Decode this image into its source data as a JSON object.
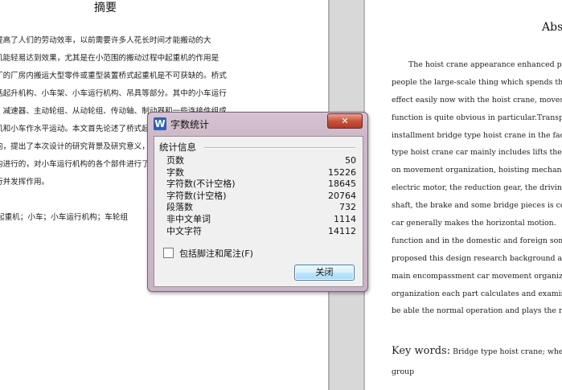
{
  "left_page": {
    "title": "摘要",
    "lines": [
      "提高了人们的劳动效率，以前需要许多人花长时间才能搬动的大",
      "机能轻易达到效果，尤其是在小范围的搬动过程中起重机的作用是",
      "厂的厂房内搬运大型零件或重型装置桥式起重机是不可获缺的。桥式",
      "括起升机构、小车架、小车运行机构、吊具等部分。其中的小车运行",
      "、减速器、主动轮组、从动轮组、传动轴、制动器和一些连接件组成",
      "机和小车作水平运动。本文首先论述了桥式起重机的发展前景与国内",
      "向，提出了本次设计的研究背景及研究意义，接下来介绍了小车运行",
      "构进行的，对小车运行机构的各个部件进行了计算和校核，以保证机",
      "行并发挥作用。"
    ],
    "keywords_line": "起重机；小车；小车运行机构；车轮组"
  },
  "right_page": {
    "title": "Abst",
    "lines": [
      "The hoist crane appearance enhanced peo",
      "people the large-scale thing which spends the",
      "effect easily now with the hoist crane, moves i",
      "function is quite obvious in particular.Transp",
      "installment bridge type hoist crane in the facto",
      "type hoist crane car mainly includes lifts the o",
      "on movement organization, hoisting mechanis",
      "electric motor, the reduction gear, the driving p",
      "shaft, the brake and some bridge pieces is com",
      "car generally makes the horizontal motion.",
      "function and in the domestic and foreign som",
      "proposed this design research background an",
      "main encompassment car movement organiz",
      "organization each part calculates and examines",
      "be able the normal operation and plays the rola"
    ],
    "keywords_label": "Key words:",
    "keywords_text": "Bridge type hoist crane; wheelba",
    "keywords_text_2": "group"
  },
  "dialog": {
    "icon": "W",
    "title": "字数统计",
    "close_glyph": "✕",
    "section_header": "统计信息",
    "stats": [
      {
        "label": "页数",
        "value": "50"
      },
      {
        "label": "字数",
        "value": "15226"
      },
      {
        "label": "字符数(不计空格)",
        "value": "18645"
      },
      {
        "label": "字符数(计空格)",
        "value": "20764"
      },
      {
        "label": "段落数",
        "value": "732"
      },
      {
        "label": "非中文单词",
        "value": "1114"
      },
      {
        "label": "中文字符",
        "value": "14112"
      }
    ],
    "checkbox_label": "包括脚注和尾注(F)",
    "checkbox_checked": false,
    "close_button_label": "关闭"
  }
}
